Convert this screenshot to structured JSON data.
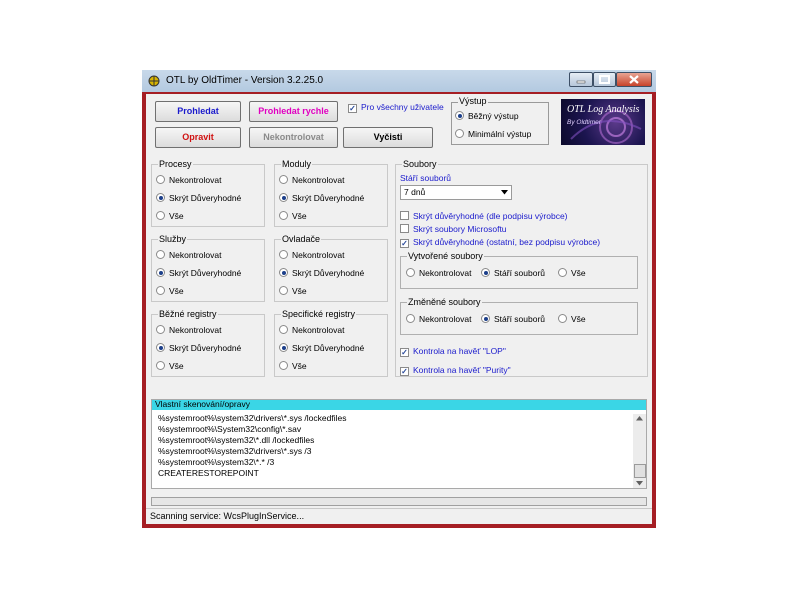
{
  "window": {
    "title": "OTL by OldTimer - Version 3.2.25.0"
  },
  "toolbar": {
    "scan_label": "Prohledat",
    "quick_scan_label": "Prohledat rychle",
    "fix_label": "Opravit",
    "no_check_label": "Nekontrolovat",
    "cleanup_label": "Vyčisti",
    "all_users_label": "Pro všechny uživatele",
    "all_users_checked": true,
    "scan_color": "#1a1acc",
    "quick_scan_color": "#e000c0",
    "fix_color": "#d01010"
  },
  "output": {
    "title": "Výstup",
    "options": [
      "Běžný výstup",
      "Minimální výstup"
    ],
    "selected": "Běžný výstup"
  },
  "logo": {
    "title": "OTL Log Analysis",
    "subtitle": "By Oldtimer"
  },
  "groups": {
    "processes": {
      "title": "Procesy",
      "options": [
        "Nekontrolovat",
        "Skrýt Důveryhodné",
        "Vše"
      ],
      "selected": 1
    },
    "modules": {
      "title": "Moduly",
      "options": [
        "Nekontrolovat",
        "Skrýt Důveryhodné",
        "Vše"
      ],
      "selected": 1
    },
    "services": {
      "title": "Služby",
      "options": [
        "Nekontrolovat",
        "Skrýt Důveryhodné",
        "Vše"
      ],
      "selected": 1
    },
    "drivers": {
      "title": "Ovladače",
      "options": [
        "Nekontrolovat",
        "Skrýt Důveryhodné",
        "Vše"
      ],
      "selected": 1
    },
    "registry": {
      "title": "Běžné registry",
      "options": [
        "Nekontrolovat",
        "Skrýt Důveryhodné",
        "Vše"
      ],
      "selected": 1
    },
    "specific_registry": {
      "title": "Specifické registry",
      "options": [
        "Nekontrolovat",
        "Skrýt Důveryhodné",
        "Vše"
      ],
      "selected": 1
    }
  },
  "files": {
    "title": "Soubory",
    "age_label": "Stáří souborů",
    "age_value": "7 dnů",
    "checks": [
      {
        "label": "Skrýt důvěryhodné (dle podpisu výrobce)",
        "checked": false
      },
      {
        "label": "Skrýt soubory Microsoftu",
        "checked": false
      },
      {
        "label": "Skrýt důvěryhodné (ostatní, bez podpisu výrobce)",
        "checked": true
      }
    ],
    "created": {
      "title": "Vytvořené soubory",
      "options": [
        "Nekontrolovat",
        "Stáří souborů",
        "Vše"
      ],
      "selected": 1
    },
    "modified": {
      "title": "Změněné soubory",
      "options": [
        "Nekontrolovat",
        "Stáří souborů",
        "Vše"
      ],
      "selected": 1
    },
    "lop_label": "Kontrola na havěť \"LOP\"",
    "lop_checked": true,
    "purity_label": "Kontrola na havěť \"Purity\"",
    "purity_checked": true
  },
  "custom_scan": {
    "title": "Vlastní skenování/opravy",
    "lines": [
      "%systemroot%\\system32\\drivers\\*.sys /lockedfiles",
      "%systemroot%\\System32\\config\\*.sav",
      "%systemroot%\\system32\\*.dll /lockedfiles",
      "%systemroot%\\system32\\drivers\\*.sys /3",
      "%systemroot%\\system32\\*.* /3",
      "CREATERESTOREPOINT"
    ]
  },
  "status": {
    "text": "Scanning service: WcsPlugInService..."
  }
}
